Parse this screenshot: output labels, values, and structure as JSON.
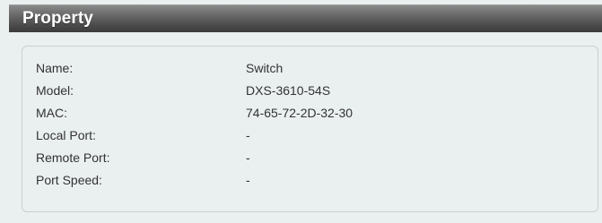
{
  "header": {
    "title": "Property"
  },
  "properties": [
    {
      "label": "Name:",
      "value": "Switch"
    },
    {
      "label": "Model:",
      "value": "DXS-3610-54S"
    },
    {
      "label": "MAC:",
      "value": "74-65-72-2D-32-30"
    },
    {
      "label": "Local Port:",
      "value": "-"
    },
    {
      "label": "Remote Port:",
      "value": "-"
    },
    {
      "label": "Port Speed:",
      "value": "-"
    }
  ],
  "colors": {
    "header_dark": "#3c3c3c",
    "panel_background": "#eaeff0",
    "box_border": "#c8d1d4",
    "text": "#333333"
  }
}
